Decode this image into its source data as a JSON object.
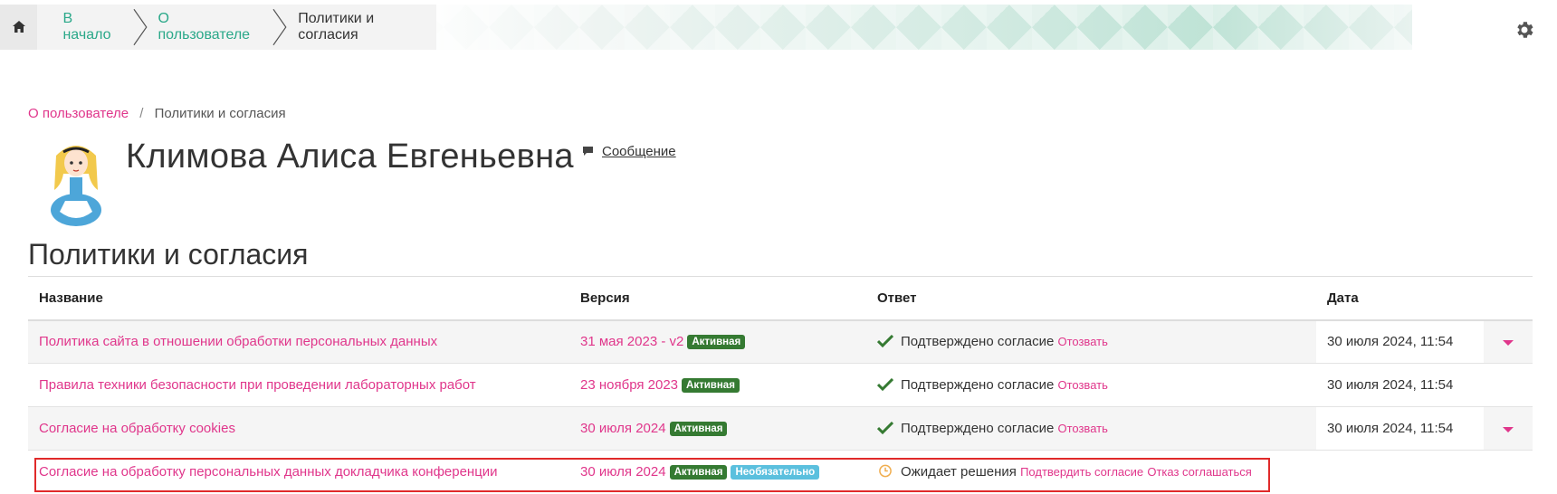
{
  "topbar": {
    "home_label": "Home",
    "crumbs": [
      "В начало",
      "О пользователе",
      "Политики и согласия"
    ]
  },
  "page_breadcrumb": {
    "link": "О пользователе",
    "separator": "/",
    "current": "Политики и согласия"
  },
  "user": {
    "name": "Климова Алиса Евгеньевна",
    "message_label": "Сообщение"
  },
  "section_title": "Политики и согласия",
  "table": {
    "headers": [
      "Название",
      "Версия",
      "Ответ",
      "Дата"
    ],
    "rows": [
      {
        "name": "Политика сайта в отношении обработки персональных данных",
        "version": "31 мая 2023 - v2",
        "badges": [
          "Активная"
        ],
        "answer_status": "Подтверждено согласие",
        "answer_actions": [
          "Отозвать"
        ],
        "date": "30 июля 2024, 11:54",
        "expandable": true
      },
      {
        "name": "Правила техники безопасности при проведении лабораторных работ",
        "version": "23 ноября 2023",
        "badges": [
          "Активная"
        ],
        "answer_status": "Подтверждено согласие",
        "answer_actions": [
          "Отозвать"
        ],
        "date": "30 июля 2024, 11:54",
        "expandable": false
      },
      {
        "name": "Согласие на обработку cookies",
        "version": "30 июля 2024",
        "badges": [
          "Активная"
        ],
        "answer_status": "Подтверждено согласие",
        "answer_actions": [
          "Отозвать"
        ],
        "date": "30 июля 2024, 11:54",
        "expandable": true
      },
      {
        "name": "Согласие на обработку персональных данных докладчика конференции",
        "version": "30 июля 2024",
        "badges": [
          "Активная",
          "Необязательно"
        ],
        "answer_status": "Ожидает решения",
        "answer_actions": [
          "Подтвердить согласие",
          "Отказ соглашаться"
        ],
        "date": "",
        "expandable": false
      }
    ]
  },
  "colors": {
    "accent": "#e0368b",
    "breadcrumb_link": "#2aa889",
    "badge_active": "#357a32",
    "badge_optional": "#5bc0de",
    "check": "#357a32",
    "pending": "#f0ad4e",
    "highlight": "#e02a2a"
  }
}
